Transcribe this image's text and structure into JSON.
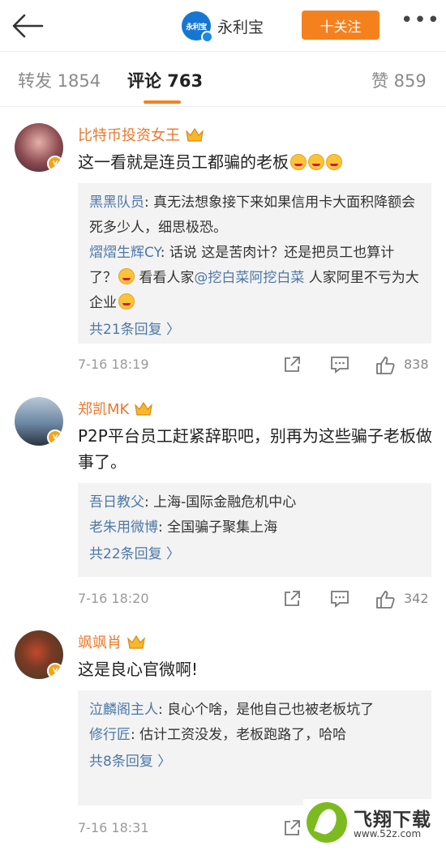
{
  "header": {
    "account_name": "永利宝",
    "logo_text": "永利宝",
    "follow_label": "十关注",
    "more_label": "•••"
  },
  "tabs": [
    {
      "label": "转发 1854"
    },
    {
      "label": "评论 763"
    },
    {
      "label": "赞 859"
    }
  ],
  "colors": {
    "accent": "#f5811e",
    "link": "#4c78a8",
    "username": "#e8792e"
  },
  "comments": [
    {
      "user": "比特币投资女王",
      "text": "这一看就是连员工都骗的老板",
      "replies": [
        {
          "user": "黑黑队员",
          "text": ": 真无法想象接下来如果信用卡大面积降额会死多少人，细思极恐。"
        },
        {
          "user": "熠熠生辉CY",
          "text_a": ": 话说 这是苦肉计？还是把员工也算计了？",
          "text_b": " 看看人家",
          "mention": "@挖白菜阿挖白菜",
          "text_c": "  人家阿里不亏为大企业"
        }
      ],
      "more": "共21条回复 〉",
      "time": "7-16 18:19",
      "likes": "838"
    },
    {
      "user": "郑凯MK",
      "text": "P2P平台员工赶紧辞职吧，别再为这些骗子老板做事了。",
      "replies": [
        {
          "user": "吾日教父",
          "text": ": 上海-国际金融危机中心"
        },
        {
          "user": "老朱用微博",
          "text": ": 全国骗子聚集上海"
        }
      ],
      "more": "共22条回复 〉",
      "time": "7-16 18:20",
      "likes": "342"
    },
    {
      "user": "飒飒肖",
      "text": "这是良心官微啊!",
      "replies": [
        {
          "user": "泣麟阁主人",
          "text": ": 良心个啥，是他自己也被老板坑了"
        },
        {
          "user": "修行匠",
          "text": ": 估计工资没发，老板跑路了，哈哈"
        }
      ],
      "more": "共8条回复 〉",
      "time": "7-16 18:31",
      "likes": ""
    }
  ],
  "watermark": {
    "title": "飞翔下载",
    "url": "www.52z.com"
  }
}
